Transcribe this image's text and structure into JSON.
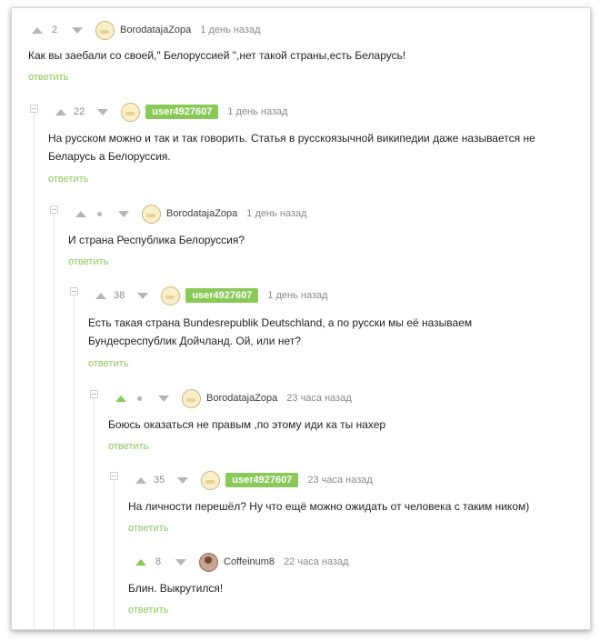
{
  "comments": [
    {
      "score": "2",
      "user": "BorodatajaZopa",
      "time": "1 день назад",
      "text": "Как вы заебали со своей,\" Белоруссией \",нет такой страны,есть Беларусь!",
      "reply": "ответить",
      "badge": false
    },
    {
      "score": "22",
      "user": "user4927607",
      "time": "1 день назад",
      "text": "На русском можно и так и так говорить. Статья в русскоязычной википедии даже называется не Беларусь а Белоруссия.",
      "reply": "ответить",
      "badge": true
    },
    {
      "score": "•",
      "user": "BorodatajaZopa",
      "time": "1 день назад",
      "text": "И страна Республика Белоруссия?",
      "reply": "ответить",
      "badge": false
    },
    {
      "score": "38",
      "user": "user4927607",
      "time": "1 день назад",
      "text": "Есть такая страна Bundesrepublik Deutschland, а по русски мы её называем Бундесреспублик Дойчланд. Ой, или нет?",
      "reply": "ответить",
      "badge": true
    },
    {
      "score": "•",
      "user": "BorodatajaZopa",
      "time": "23 часа назад",
      "text": "Боюсь оказаться не правым ,по этому иди ка ты нахер",
      "reply": "ответить",
      "badge": false
    },
    {
      "score": "35",
      "user": "user4927607",
      "time": "23 часа назад",
      "text": "На личности перешёл? Ну что ещё можно ожидать от человека с таким ником)",
      "reply": "ответить",
      "badge": true
    },
    {
      "score": "8",
      "user": "Coffeinum8",
      "time": "22 часа назад",
      "text": "Блин. Выкрутился!",
      "reply": "ответить",
      "badge": false
    }
  ]
}
